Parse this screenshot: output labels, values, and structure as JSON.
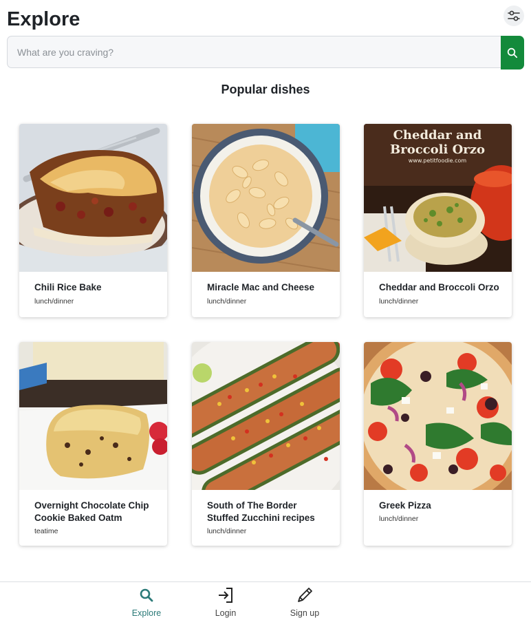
{
  "header": {
    "title": "Explore",
    "filter_icon": "sliders-icon"
  },
  "search": {
    "placeholder": "What are you craving?",
    "value": "",
    "button_icon": "search-icon"
  },
  "section": {
    "title": "Popular dishes"
  },
  "dishes": [
    {
      "name": "Chili Rice Bake",
      "category": "lunch/dinner"
    },
    {
      "name": "Miracle Mac and Cheese",
      "category": "lunch/dinner"
    },
    {
      "name": "Cheddar and Broccoli Orzo",
      "category": "lunch/dinner",
      "image_text": [
        "Cheddar and",
        "Broccoli Orzo",
        "www.petitfoodie.com"
      ]
    },
    {
      "name": "Overnight Chocolate Chip Cookie Baked Oatm",
      "category": "teatime"
    },
    {
      "name": "South of The Border Stuffed Zucchini recipes",
      "category": "lunch/dinner"
    },
    {
      "name": "Greek Pizza",
      "category": "lunch/dinner"
    }
  ],
  "nav": [
    {
      "label": "Explore",
      "icon": "search-icon",
      "active": true
    },
    {
      "label": "Login",
      "icon": "login-icon",
      "active": false
    },
    {
      "label": "Sign up",
      "icon": "pencil-icon",
      "active": false
    }
  ],
  "colors": {
    "accent_green": "#138a3b",
    "active_nav": "#2b7a78"
  }
}
